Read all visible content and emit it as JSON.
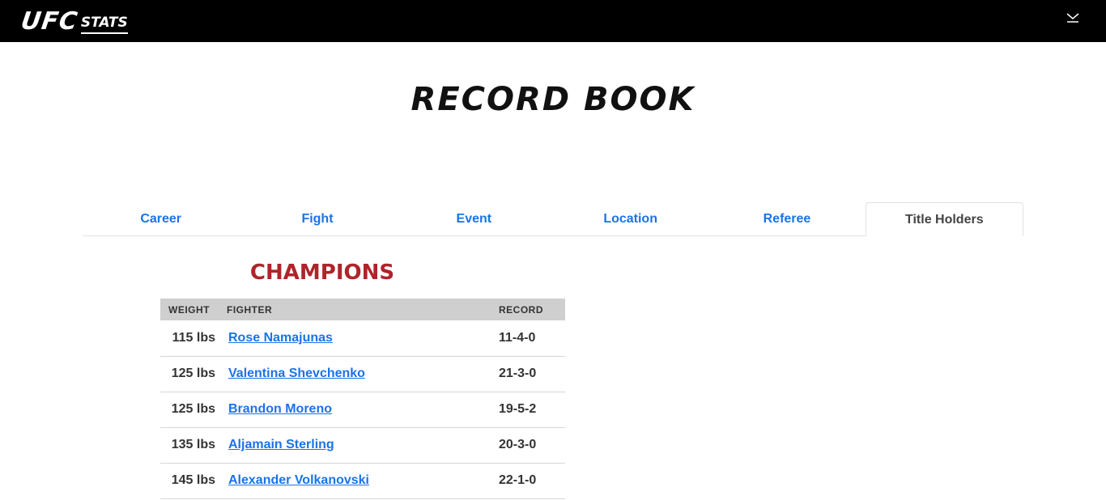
{
  "header": {
    "logo_ufc": "UFC",
    "logo_stats": "STATS",
    "menu_icon": "chevron-down-icon"
  },
  "page": {
    "title": "RECORD BOOK"
  },
  "tabs": [
    {
      "label": "Career",
      "active": false
    },
    {
      "label": "Fight",
      "active": false
    },
    {
      "label": "Event",
      "active": false
    },
    {
      "label": "Location",
      "active": false
    },
    {
      "label": "Referee",
      "active": false
    },
    {
      "label": "Title Holders",
      "active": true
    }
  ],
  "champions": {
    "title": "CHAMPIONS",
    "columns": {
      "weight": "WEIGHT",
      "fighter": "FIGHTER",
      "record": "RECORD"
    },
    "rows": [
      {
        "weight": "115 lbs",
        "fighter": "Rose Namajunas",
        "record": "11-4-0"
      },
      {
        "weight": "125 lbs",
        "fighter": "Valentina Shevchenko",
        "record": "21-3-0"
      },
      {
        "weight": "125 lbs",
        "fighter": "Brandon Moreno",
        "record": "19-5-2"
      },
      {
        "weight": "135 lbs",
        "fighter": "Aljamain Sterling",
        "record": "20-3-0"
      },
      {
        "weight": "145 lbs",
        "fighter": "Alexander Volkanovski",
        "record": "22-1-0"
      }
    ]
  },
  "colors": {
    "link": "#1a73e8",
    "champions_title": "#b0232a",
    "header_bg": "#000000",
    "table_header_bg": "#cfcfcf"
  }
}
